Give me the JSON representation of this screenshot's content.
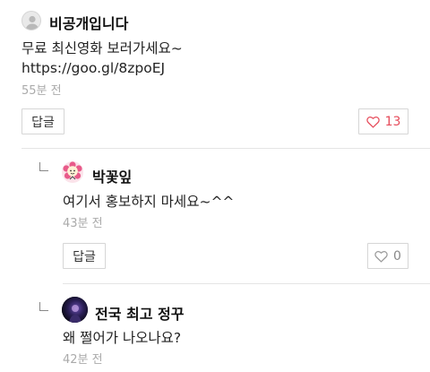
{
  "comments": [
    {
      "author": "비공개입니다",
      "avatar_icon": "default-user-avatar-icon",
      "lines": [
        "무료 최신영화 보러가세요~",
        "https://goo.gl/8zpoEJ"
      ],
      "time": "55분 전",
      "reply_label": "답글",
      "like_count": "13",
      "liked": true
    },
    {
      "author": "박꽃잎",
      "avatar_icon": "flower-character-avatar-icon",
      "lines": [
        "여기서 홍보하지 마세요~^^"
      ],
      "time": "43분 전",
      "reply_label": "답글",
      "like_count": "0",
      "liked": false
    },
    {
      "author": "전국 최고 정꾸",
      "avatar_icon": "night-photo-avatar-icon",
      "lines": [
        "왜 쩔어가 나오나요?"
      ],
      "time": "42분 전"
    }
  ],
  "colors": {
    "like_active": "#e64b5a",
    "like_inactive": "#999999"
  }
}
